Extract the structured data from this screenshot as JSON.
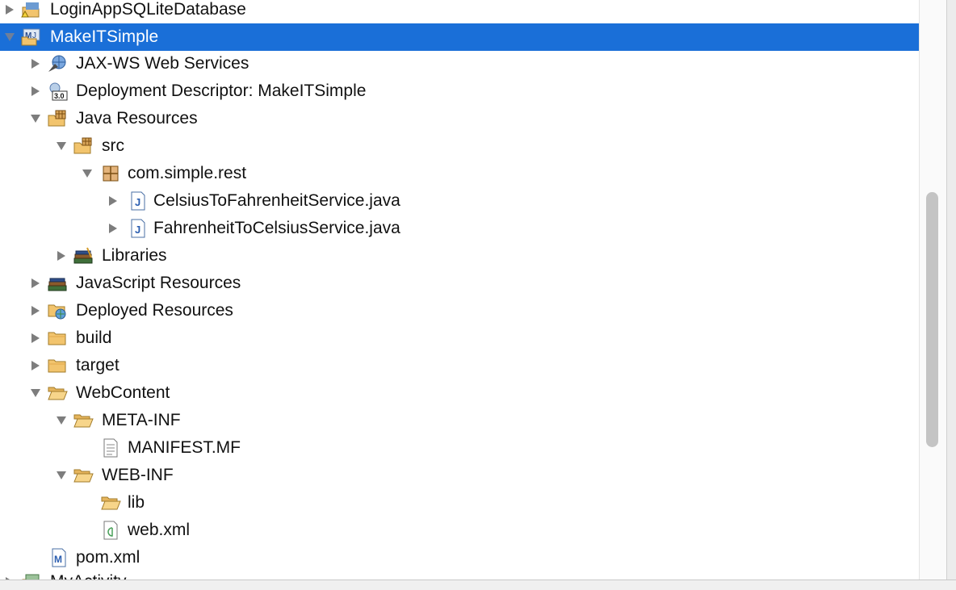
{
  "tree": {
    "items": [
      {
        "label": "LoginAppSQLiteDatabase",
        "icon": "project-warning-icon",
        "expanded": false
      },
      {
        "label": "MakeITSimple",
        "icon": "maven-project-icon",
        "expanded": true,
        "selected": true
      },
      {
        "label": "JAX-WS Web Services",
        "icon": "webservices-icon",
        "expanded": false
      },
      {
        "label": "Deployment Descriptor: MakeITSimple",
        "icon": "deployment-descriptor-icon",
        "badge": "3.0",
        "expanded": false
      },
      {
        "label": "Java Resources",
        "icon": "java-resources-icon",
        "expanded": true
      },
      {
        "label": "src",
        "icon": "source-folder-icon",
        "expanded": true
      },
      {
        "label": "com.simple.rest",
        "icon": "package-icon",
        "expanded": true
      },
      {
        "label": "CelsiusToFahrenheitService.java",
        "icon": "java-file-icon",
        "expanded": false
      },
      {
        "label": "FahrenheitToCelsiusService.java",
        "icon": "java-file-icon",
        "expanded": false
      },
      {
        "label": "Libraries",
        "icon": "libraries-icon",
        "expanded": false
      },
      {
        "label": "JavaScript Resources",
        "icon": "javascript-resources-icon",
        "expanded": false
      },
      {
        "label": "Deployed Resources",
        "icon": "deployed-resources-icon",
        "expanded": false
      },
      {
        "label": "build",
        "icon": "folder-icon",
        "expanded": false
      },
      {
        "label": "target",
        "icon": "folder-icon",
        "expanded": false
      },
      {
        "label": "WebContent",
        "icon": "folder-open-icon",
        "expanded": true
      },
      {
        "label": "META-INF",
        "icon": "folder-open-icon",
        "expanded": true
      },
      {
        "label": "MANIFEST.MF",
        "icon": "text-file-icon"
      },
      {
        "label": "WEB-INF",
        "icon": "folder-open-icon",
        "expanded": true
      },
      {
        "label": "lib",
        "icon": "folder-open-icon"
      },
      {
        "label": "web.xml",
        "icon": "xml-file-icon"
      },
      {
        "label": "pom.xml",
        "icon": "maven-pom-icon"
      },
      {
        "label": "MyActivity",
        "icon": "project-icon",
        "expanded": false
      }
    ]
  },
  "colors": {
    "selection": "#1a6fd8",
    "folder": "#f2c46d",
    "text": "#111111"
  }
}
